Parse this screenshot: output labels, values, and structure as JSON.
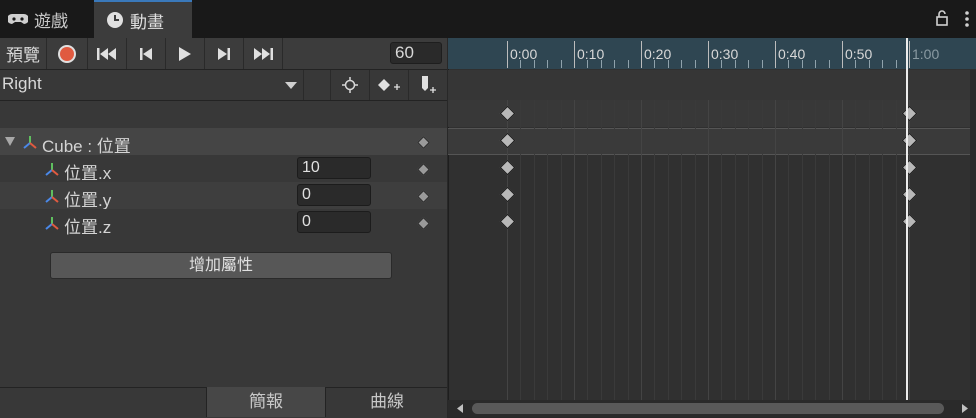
{
  "tabs": [
    {
      "label": "遊戲",
      "icon": "gamepad-icon"
    },
    {
      "label": "動畫",
      "icon": "clock-icon"
    }
  ],
  "window_controls": {
    "lock_icon": "lock-icon",
    "menu_icon": "kebab-menu-icon"
  },
  "toolbar": {
    "preview_label": "預覽",
    "record_icon": "record-icon",
    "first_key_icon": "first-keyframe-icon",
    "prev_key_icon": "previous-keyframe-icon",
    "play_icon": "play-icon",
    "next_key_icon": "next-keyframe-icon",
    "last_key_icon": "last-keyframe-icon",
    "frame_value": "60"
  },
  "clip": {
    "selected": "Right",
    "filter_icon": "filter-keyframes-icon",
    "add_keyframe_icon": "add-keyframe-icon",
    "add_event_icon": "add-event-icon"
  },
  "properties": {
    "group_label": "Cube : 位置",
    "rows": [
      {
        "label": "位置.x",
        "value": "10"
      },
      {
        "label": "位置.y",
        "value": "0"
      },
      {
        "label": "位置.z",
        "value": "0"
      }
    ],
    "add_property_label": "增加屬性"
  },
  "bottom_tabs": {
    "dopesheet_label": "簡報",
    "curves_label": "曲線"
  },
  "timeline": {
    "labels": [
      "0:00",
      "0:10",
      "0:20",
      "0:30",
      "0:40",
      "0:50",
      "1:00"
    ],
    "playhead_time": "1:00",
    "keyframe_times": [
      "0:00",
      "1:00"
    ]
  },
  "colors": {
    "ruler_bg": "#2f4652",
    "record": "#e05a40",
    "accent_tab": "#3a79bb"
  }
}
